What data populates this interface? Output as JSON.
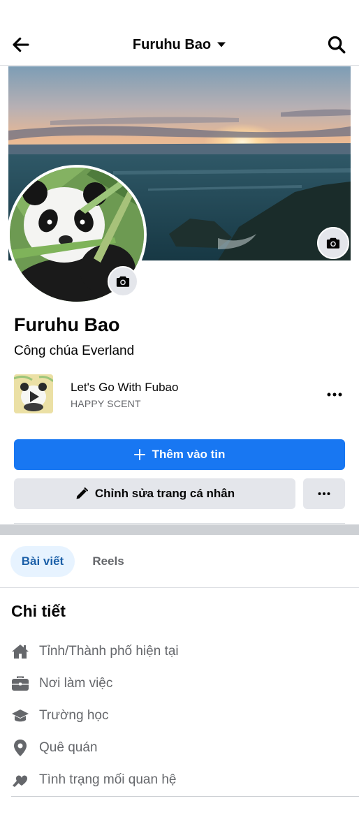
{
  "header": {
    "back_icon": "arrow-left-icon",
    "title": "Furuhu Bao",
    "dropdown_icon": "caret-down-icon",
    "search_icon": "search-icon"
  },
  "profile": {
    "name": "Furuhu Bao",
    "bio": "Công chúa Everland",
    "cover_camera_icon": "camera-icon",
    "avatar_camera_icon": "camera-icon"
  },
  "music": {
    "title": "Let's Go With Fubao",
    "artist": "HAPPY SCENT",
    "more_icon": "more-horizontal-icon"
  },
  "actions": {
    "add_story_label": "Thêm vào tin",
    "edit_profile_label": "Chỉnh sửa trang cá nhân",
    "more_icon": "more-horizontal-icon"
  },
  "tabs": [
    {
      "label": "Bài viết",
      "active": true
    },
    {
      "label": "Reels",
      "active": false
    }
  ],
  "details": {
    "title": "Chi tiết",
    "items": [
      {
        "icon": "home-icon",
        "label": "Tỉnh/Thành phố hiện tại"
      },
      {
        "icon": "briefcase-icon",
        "label": "Nơi làm việc"
      },
      {
        "icon": "graduation-cap-icon",
        "label": "Trường học"
      },
      {
        "icon": "location-pin-icon",
        "label": "Quê quán"
      },
      {
        "icon": "heart-icon",
        "label": "Tình trạng mối quan hệ"
      }
    ]
  },
  "colors": {
    "primary": "#1877f2",
    "tab_active_bg": "#e7f3ff",
    "tab_active_text": "#1b5fa8",
    "secondary_button": "#e4e6eb",
    "muted_text": "#65676b"
  }
}
